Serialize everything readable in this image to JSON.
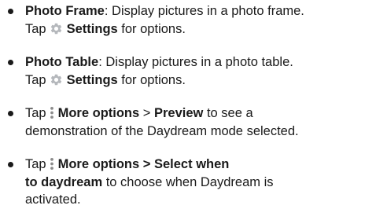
{
  "colors": {
    "text": "#1a1a1a",
    "gear_icon": "#b5b8bc",
    "dots_icon": "#8c8c8c"
  },
  "items": [
    {
      "name": "Photo Frame",
      "desc": ": Display pictures in a photo frame.",
      "tap": "Tap",
      "icon": "gear-icon",
      "settings": "Settings",
      "tail": " for options."
    },
    {
      "name": "Photo Table",
      "desc": ": Display pictures in a photo table.",
      "tap": "Tap",
      "icon": "gear-icon",
      "settings": "Settings",
      "tail": " for options."
    },
    {
      "tap": "Tap",
      "icon": "more-options-icon",
      "more": "More options",
      "sep": " > ",
      "preview": "Preview",
      "tail1": " to see a",
      "line2": "demonstration of the Daydream mode selected."
    },
    {
      "tap": "Tap",
      "icon": "more-options-icon",
      "bold1": "More options > Select when",
      "bold2": "to daydream",
      "tail2": " to choose when Daydream is",
      "line3": "activated."
    }
  ]
}
